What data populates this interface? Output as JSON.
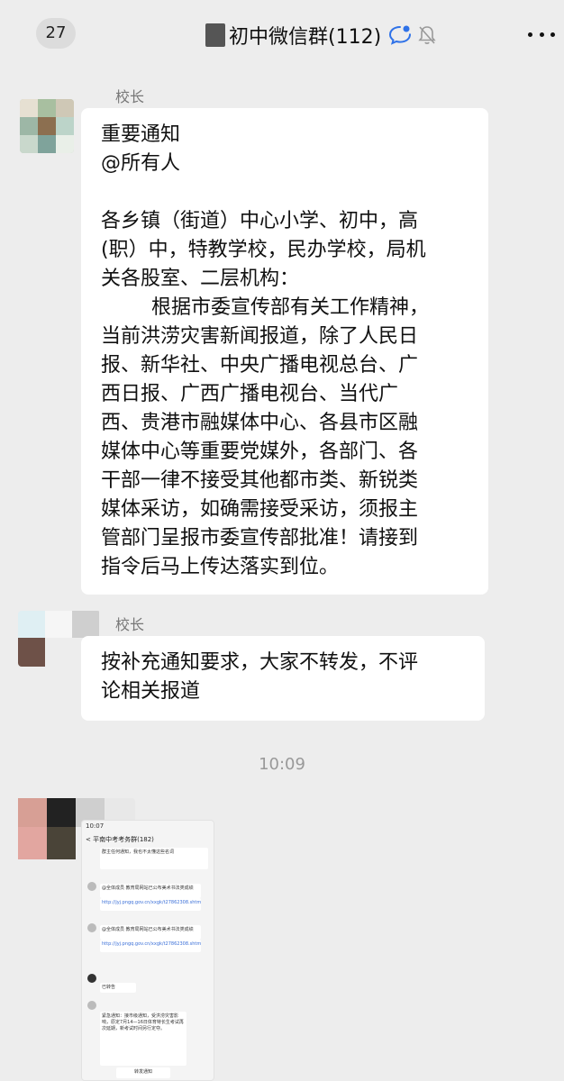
{
  "header": {
    "back_count": "27",
    "title": "初中微信群(112)",
    "icons": [
      "chat-bubble-icon",
      "mute-bell-icon",
      "more-icon"
    ]
  },
  "messages": [
    {
      "sender": "校长",
      "lines": [
        "重要通知",
        "@所有人",
        "",
        "各乡镇（街道）中心小学、初中，高",
        "(职）中，特教学校，民办学校，局机",
        "关各股室、二层机构：",
        "        根据市委宣传部有关工作精神，",
        "当前洪涝灾害新闻报道，除了人民日",
        "报、新华社、中央广播电视总台、广",
        "西日报、广西广播电视台、当代广",
        "西、贵港市融媒体中心、各县市区融",
        "媒体中心等重要党媒外，各部门、各",
        "干部一律不接受其他都市类、新锐类",
        "媒体采访，如确需接受采访，须报主",
        "管部门呈报市委宣传部批准！请接到",
        "指令后马上传达落实到位。"
      ]
    },
    {
      "sender": "校长",
      "lines": [
        "按补充通知要求，大家不转发，不评",
        "论相关报道"
      ]
    }
  ],
  "timestamp": "10:09",
  "screenshot_preview": {
    "status_time": "10:07",
    "title": "< 平南中考考务群(182)",
    "items": [
      "群主任何通知，我也不太懂这些名词",
      "@全体成员 教育局网站已公布美术书法类成绩",
      "http://jyj.pngq.gov.cn/xxgk/t27862308.shtml",
      "@全体成员 教育局网站已公布美术书法类成绩",
      "http://jyj.pngq.gov.cn/xxgk/t27862308.shtml",
      "已转告",
      "紧急通知：接市级通知，受洪涝灾害影响，原定7月14—16日体育特长生考试再次延期，新考试时间另行定夺。",
      "转发通知"
    ]
  }
}
